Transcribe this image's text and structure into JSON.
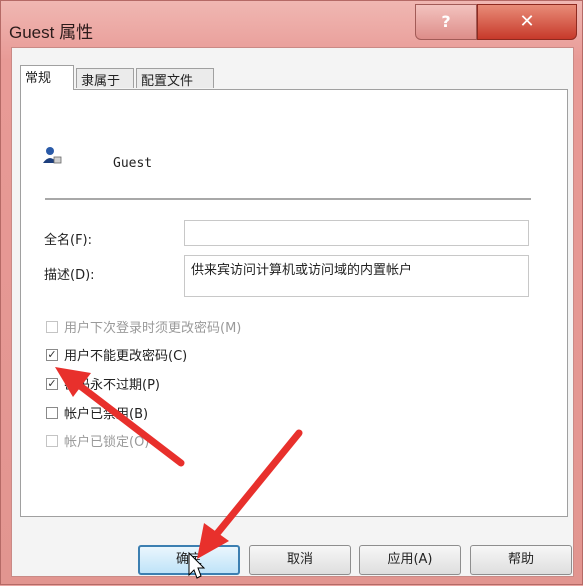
{
  "window": {
    "title": "Guest 属性",
    "help_label": "?",
    "close_label": "✕"
  },
  "tabs": [
    {
      "label": "常规",
      "active": true
    },
    {
      "label": "隶属于",
      "active": false
    },
    {
      "label": "配置文件",
      "active": false
    }
  ],
  "user": {
    "name": "Guest",
    "icon": "user-icon"
  },
  "fields": {
    "fullname_label": "全名(F):",
    "fullname_value": "",
    "description_label": "描述(D):",
    "description_value": "供来宾访问计算机或访问域的内置帐户"
  },
  "checkboxes": [
    {
      "label": "用户下次登录时须更改密码(M)",
      "checked": false,
      "enabled": false
    },
    {
      "label": "用户不能更改密码(C)",
      "checked": true,
      "enabled": true
    },
    {
      "label": "密码永不过期(P)",
      "checked": true,
      "enabled": true
    },
    {
      "label": "帐户已禁用(B)",
      "checked": false,
      "enabled": true
    },
    {
      "label": "帐户已锁定(O)",
      "checked": false,
      "enabled": false
    }
  ],
  "buttons": {
    "ok": "确定",
    "cancel": "取消",
    "apply": "应用(A)",
    "help": "帮助"
  },
  "annotation_color": "#e8302c"
}
